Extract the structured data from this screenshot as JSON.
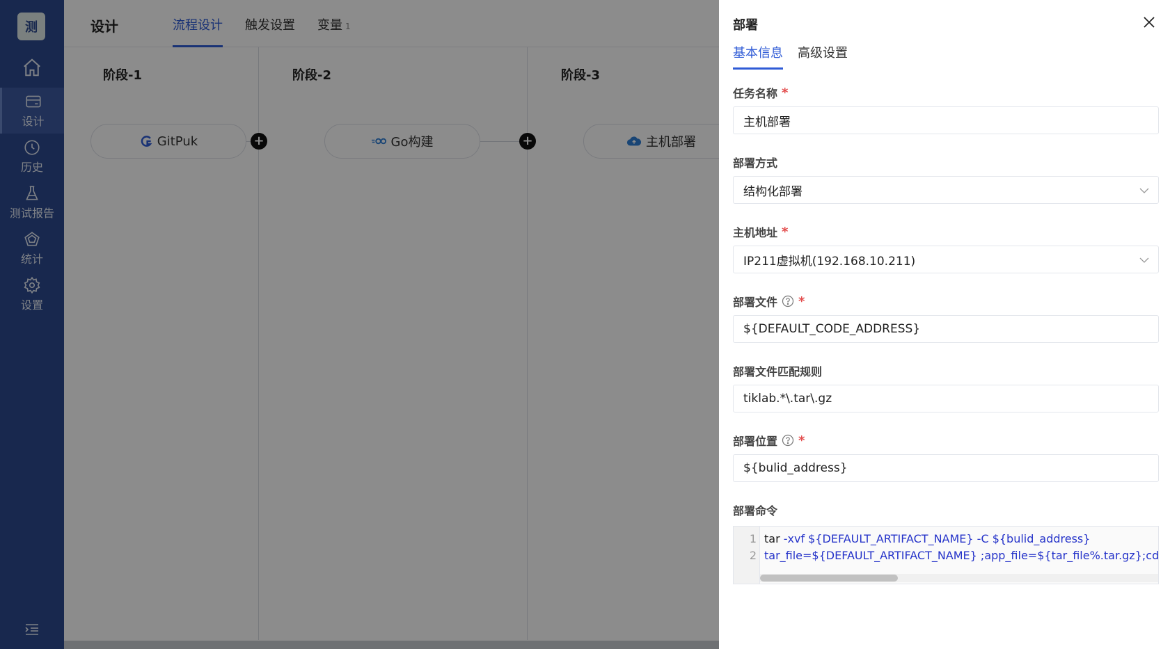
{
  "sidebar": {
    "logo": "测",
    "items": [
      {
        "label": "设计",
        "icon": "card-icon"
      },
      {
        "label": "历史",
        "icon": "clock-icon"
      },
      {
        "label": "测试报告",
        "icon": "flask-icon"
      },
      {
        "label": "统计",
        "icon": "chart-icon"
      },
      {
        "label": "设置",
        "icon": "gear-icon"
      }
    ]
  },
  "header": {
    "title": "设计",
    "tabs": [
      {
        "label": "流程设计"
      },
      {
        "label": "触发设置"
      },
      {
        "label": "变量",
        "badge": "1"
      }
    ]
  },
  "pipeline": {
    "stages": [
      {
        "title": "阶段-1",
        "task": "GitPuk"
      },
      {
        "title": "阶段-2",
        "task": "Go构建"
      },
      {
        "title": "阶段-3",
        "task": "主机部署"
      }
    ]
  },
  "drawer": {
    "title": "部署",
    "tabs": [
      "基本信息",
      "高级设置"
    ],
    "fields": {
      "task_name": {
        "label": "任务名称",
        "value": "主机部署"
      },
      "deploy_mode": {
        "label": "部署方式",
        "value": "结构化部署"
      },
      "host": {
        "label": "主机地址",
        "value": "IP211虚拟机(192.168.10.211)"
      },
      "deploy_file": {
        "label": "部署文件",
        "value": "${DEFAULT_CODE_ADDRESS}"
      },
      "match_rule": {
        "label": "部署文件匹配规则",
        "value": "tiklab.*\\.tar\\.gz"
      },
      "deploy_location": {
        "label": "部署位置",
        "value": "${bulid_address}"
      },
      "deploy_command": {
        "label": "部署命令",
        "lines": [
          {
            "num": "1",
            "cmd": "tar",
            "rest": " -xvf  ${DEFAULT_ARTIFACT_NAME} -C ${bulid_address}"
          },
          {
            "num": "2",
            "cmd": "",
            "rest": "tar_file=${DEFAULT_ARTIFACT_NAME} ;app_file=${tar_file%.tar.gz};cd ${bul"
          }
        ]
      }
    }
  },
  "colors": {
    "accent": "#2f5bd6",
    "sidebar": "#2d4a8e",
    "required": "#e34d4d"
  }
}
